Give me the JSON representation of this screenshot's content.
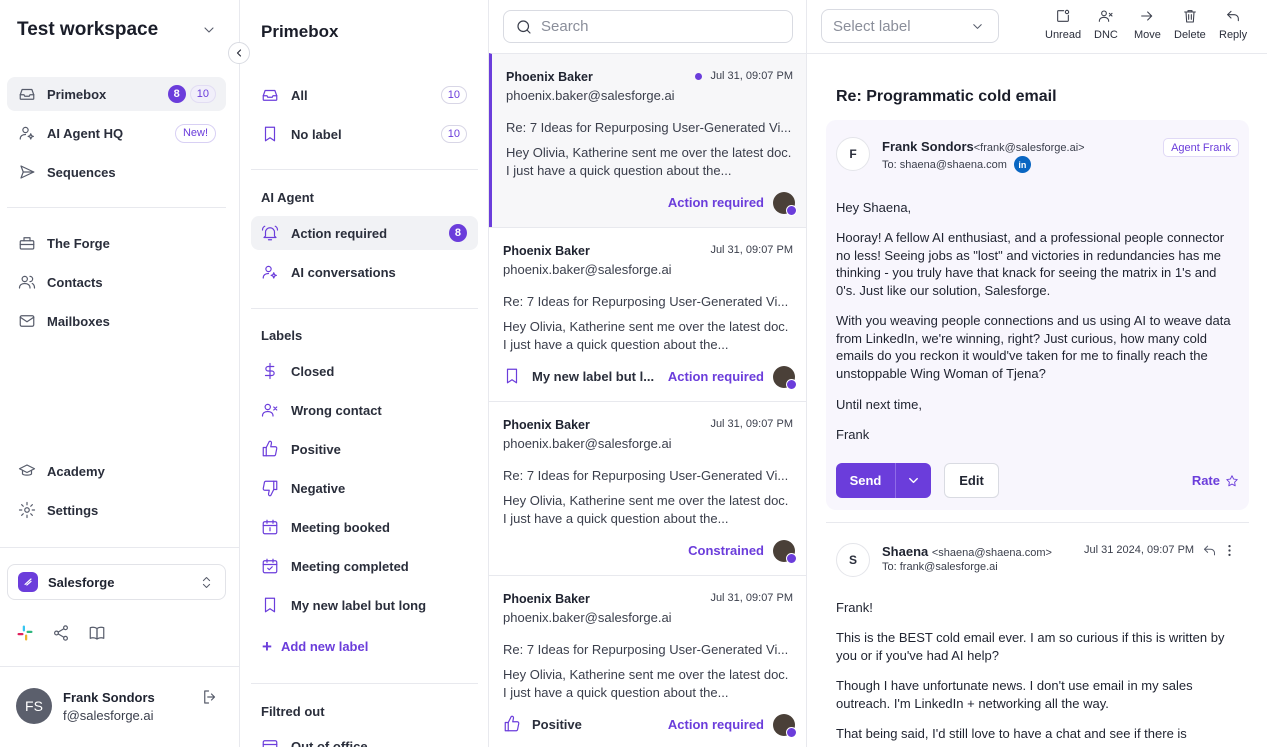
{
  "sidebar": {
    "workspace": "Test workspace",
    "items": [
      {
        "label": "Primebox",
        "badge_unread": "8",
        "badge_total": "10"
      },
      {
        "label": "AI Agent HQ",
        "badge_new": "New!"
      },
      {
        "label": "Sequences"
      },
      {
        "label": "The Forge"
      },
      {
        "label": "Contacts"
      },
      {
        "label": "Mailboxes"
      },
      {
        "label": "Academy"
      },
      {
        "label": "Settings"
      }
    ],
    "org": "Salesforge",
    "user": {
      "initials": "FS",
      "name": "Frank Sondors",
      "email": "f@salesforge.ai"
    }
  },
  "folders": {
    "title": "Primebox",
    "all": {
      "label": "All",
      "count": "10"
    },
    "no_label": {
      "label": "No label",
      "count": "10"
    },
    "ai_agent_heading": "AI Agent",
    "action_required": {
      "label": "Action required",
      "count": "8"
    },
    "ai_conversations": "AI conversations",
    "labels_heading": "Labels",
    "labels": [
      "Closed",
      "Wrong contact",
      "Positive",
      "Negative",
      "Meeting booked",
      "Meeting completed",
      "My new label but long"
    ],
    "add_label": "Add new label",
    "filtered_heading": "Filtred out",
    "filtered_item": "Out of office"
  },
  "list": {
    "search_placeholder": "Search",
    "messages": [
      {
        "from": "Phoenix Baker",
        "email": "phoenix.baker@salesforge.ai",
        "time": "Jul 31, 09:07 PM",
        "subject": "Re: 7 Ideas for Repurposing User-Generated Vi...",
        "preview": "Hey Olivia, Katherine sent me over the latest doc. I just have a quick question about the...",
        "status": "Action required",
        "label": ""
      },
      {
        "from": "Phoenix Baker",
        "email": "phoenix.baker@salesforge.ai",
        "time": "Jul 31, 09:07 PM",
        "subject": "Re: 7 Ideas for Repurposing User-Generated Vi...",
        "preview": "Hey Olivia, Katherine sent me over the latest doc. I just have a quick question about the...",
        "status": "Action required",
        "label": "My new label but l..."
      },
      {
        "from": "Phoenix Baker",
        "email": "phoenix.baker@salesforge.ai",
        "time": "Jul 31, 09:07 PM",
        "subject": "Re: 7 Ideas for Repurposing User-Generated Vi...",
        "preview": "Hey Olivia, Katherine sent me over the latest doc. I just have a quick question about the...",
        "status": "Constrained",
        "label": ""
      },
      {
        "from": "Phoenix Baker",
        "email": "phoenix.baker@salesforge.ai",
        "time": "Jul 31, 09:07 PM",
        "subject": "Re: 7 Ideas for Repurposing User-Generated Vi...",
        "preview": "Hey Olivia, Katherine sent me over the latest doc. I just have a quick question about the...",
        "status": "Action required",
        "label": "Positive"
      }
    ]
  },
  "pane": {
    "label_placeholder": "Select label",
    "tools": [
      "Unread",
      "DNC",
      "Move",
      "Delete",
      "Reply"
    ],
    "title": "Re: Programmatic cold email",
    "draft": {
      "avatar": "F",
      "sender": "Frank Sondors",
      "sender_email": "<frank@salesforge.ai>",
      "to": "To: shaena@shaena.com",
      "linkedin": "in",
      "tag": "Agent Frank",
      "paragraphs": [
        "Hey Shaena,",
        "Hooray! A fellow AI enthusiast, and a professional people connector no less! Seeing jobs as \"lost\" and victories in redundancies has me thinking - you truly have that knack for seeing the matrix in 1's and 0's. Just like our solution, Salesforge.",
        "With you weaving people connections and us using AI to weave data from LinkedIn, we're winning, right? Just curious, how many cold emails do you reckon it would've taken for me to finally reach the unstoppable Wing Woman of Tjena?",
        "Until next time,",
        "Frank"
      ],
      "send": "Send",
      "edit": "Edit",
      "rate": "Rate"
    },
    "reply": {
      "avatar": "S",
      "sender": "Shaena",
      "sender_email": "<shaena@shaena.com>",
      "to": "To: frank@salesforge.ai",
      "time": "Jul 31 2024, 09:07 PM",
      "paragraphs": [
        "Frank!",
        "This is the BEST cold email ever. I am so curious if this is written by you or if you've had AI help?",
        "Though I have unfortunate news. I don't use email in my sales outreach. I'm LinkedIn + networking all the way.",
        "That being said, I'd still love to have a chat and see if there is"
      ]
    }
  },
  "colors": {
    "accent": "#6b3ddb",
    "linkedin": "#0a66c2"
  }
}
